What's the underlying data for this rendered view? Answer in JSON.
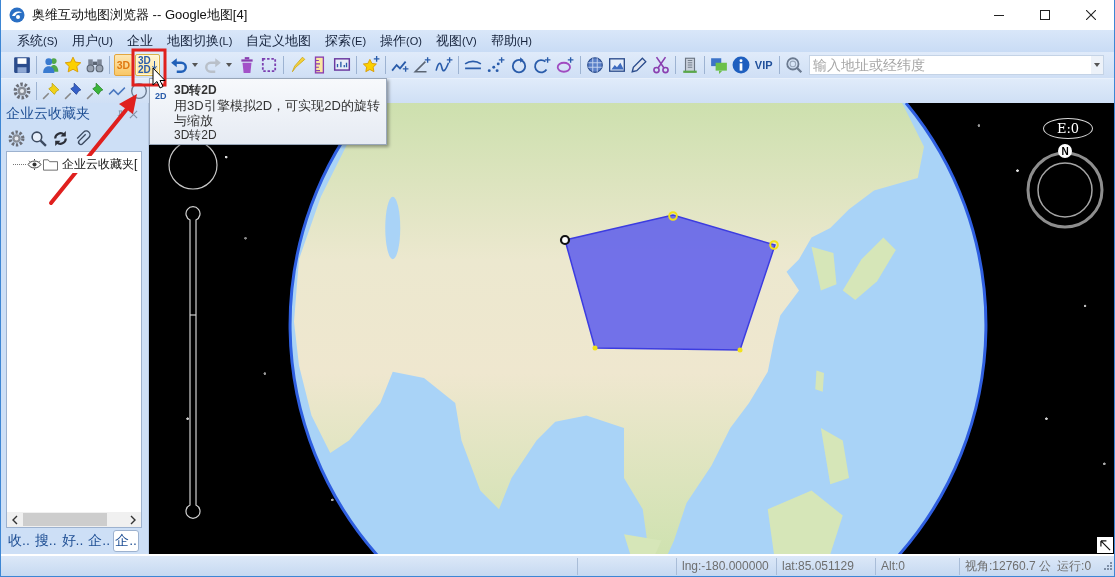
{
  "window": {
    "title": "奥维互动地图浏览器 -- Google地图[4]"
  },
  "menu": [
    {
      "label": "系统",
      "accel": "(S)"
    },
    {
      "label": "用户",
      "accel": "(U)"
    },
    {
      "label": "企业"
    },
    {
      "label": "地图切换",
      "accel": "(L)"
    },
    {
      "label": "自定义地图"
    },
    {
      "label": "探索",
      "accel": "(E)"
    },
    {
      "label": "操作",
      "accel": "(O)"
    },
    {
      "label": "视图",
      "accel": "(V)"
    },
    {
      "label": "帮助",
      "accel": "(H)"
    }
  ],
  "toolbar": {
    "view_modes": [
      {
        "kind": "toggle",
        "lines": [
          "3D"
        ],
        "selected": true,
        "hovered": false
      },
      {
        "kind": "convert",
        "lines": [
          "3D",
          "2D"
        ],
        "selected": false,
        "hovered": true
      }
    ],
    "redo": {
      "disabled": true
    },
    "vip": "VIP",
    "search": {
      "placeholder": "输入地址或经纬度"
    }
  },
  "tooltip": {
    "icon_text": "2D",
    "title": "3D转2D",
    "description": "用3D引擎模拟2D，可实现2D的旋转与缩放",
    "footer": "3D转2D"
  },
  "sidebar": {
    "title": "企业云收藏夹",
    "tree": [
      {
        "label": "企业云收藏夹["
      }
    ],
    "tabs": [
      {
        "label": "收..",
        "selected": false
      },
      {
        "label": "搜..",
        "selected": false
      },
      {
        "label": "好..",
        "selected": false
      },
      {
        "label": "企..",
        "selected": false
      },
      {
        "label": "企..",
        "selected": true
      }
    ]
  },
  "map": {
    "heading": "E:0",
    "north": "N"
  },
  "status_bar": {
    "lng": "lng:-180.000000",
    "lat": "lat:85.051129",
    "alt": "Alt:0",
    "view": "视角:12760.7 公",
    "run": "运行:0"
  }
}
